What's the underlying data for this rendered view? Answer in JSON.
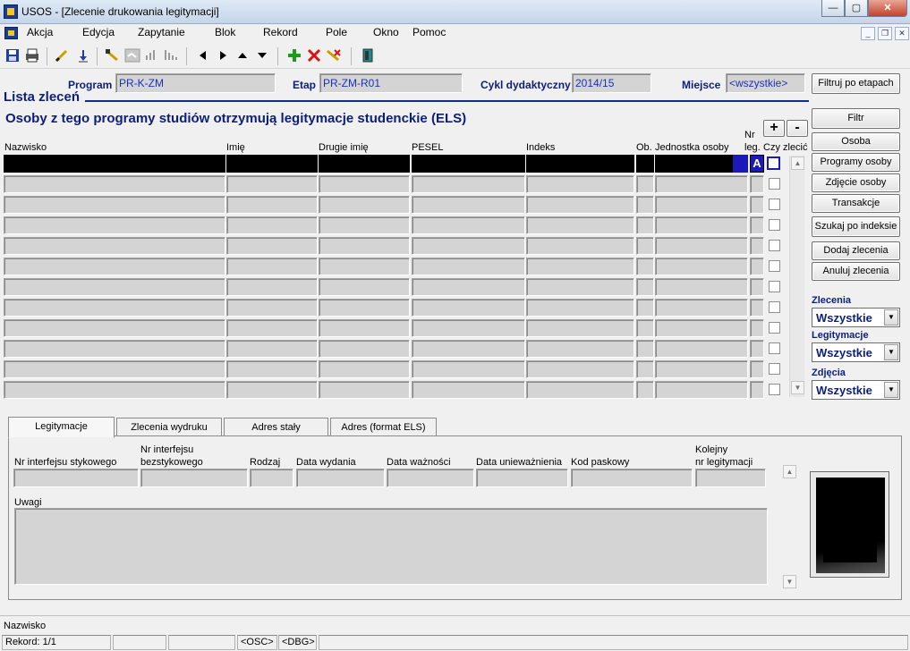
{
  "window": {
    "title": "USOS - [Zlecenie drukowania legitymacji]",
    "minimize": "—",
    "maximize": "▢",
    "close": "✕"
  },
  "menu": [
    "Akcja",
    "Edycja",
    "Zapytanie",
    "Blok",
    "Rekord",
    "Pole",
    "Okno",
    "Pomoc"
  ],
  "mdi": {
    "minimize": "_",
    "restore": "❐",
    "close": "✕"
  },
  "header": {
    "program_label": "Program",
    "program_value": "PR-K-ZM",
    "etap_label": "Etap",
    "etap_value": "PR-ZM-R01",
    "cykl_label": "Cykl dydaktyczny",
    "cykl_value": "2014/15",
    "miejsce_label": "Miejsce",
    "miejsce_value": "<wszystkie>",
    "filter_stages_button": "Filtruj po etapach"
  },
  "list": {
    "title": "Lista zleceń",
    "subtitle": "Osoby z tego programy studiów otrzymują legitymacje studenckie (ELS)",
    "plus": "+",
    "minus": "-",
    "columns": {
      "nazwisko": "Nazwisko",
      "imie": "Imię",
      "drugie_imie": "Drugie imię",
      "pesel": "PESEL",
      "indeks": "Indeks",
      "ob": "Ob.",
      "jednostka": "Jednostka osoby",
      "nr_leg_1": "Nr",
      "nr_leg_2": "leg.",
      "czy_zlecic": "Czy zlecić"
    },
    "selected_row_marker": "A",
    "row_count": 12
  },
  "side_buttons": {
    "filtr": "Filtr",
    "osoba": "Osoba",
    "programy_osoby": "Programy osoby",
    "zdjecie_osoby": "Zdjęcie osoby",
    "transakcje": "Transakcje",
    "szukaj_po_indeksie": "Szukaj po indeksie",
    "dodaj_zlecenia": "Dodaj zlecenia",
    "anuluj_zlecenia": "Anuluj zlecenia"
  },
  "filters": {
    "zlecenia_label": "Zlecenia",
    "zlecenia_value": "Wszystkie",
    "legitymacje_label": "Legitymacje",
    "legitymacje_value": "Wszystkie",
    "zdjecia_label": "Zdjęcia",
    "zdjecia_value": "Wszystkie"
  },
  "tabs": [
    "Legitymacje",
    "Zlecenia wydruku",
    "Adres stały",
    "Adres (format ELS)"
  ],
  "details": {
    "nr_stykowego": "Nr interfejsu stykowego",
    "nr_bezstykowego_1": "Nr interfejsu",
    "nr_bezstykowego_2": "bezstykowego",
    "rodzaj": "Rodzaj",
    "data_wydania": "Data wydania",
    "data_waznosci": "Data ważności",
    "data_uniewaznienia": "Data unieważnienia",
    "kod_paskowy": "Kod paskowy",
    "kolejny_1": "Kolejny",
    "kolejny_2": "nr legitymacji",
    "uwagi": "Uwagi"
  },
  "status": {
    "message": "Nazwisko",
    "record": "Rekord: 1/1",
    "osc": "<OSC>",
    "dbg": "<DBG>"
  },
  "colors": {
    "accent": "#0c1e7a",
    "field_text": "#1b32b8",
    "selection": "#000000",
    "marker_bg": "#1a1ab8"
  }
}
